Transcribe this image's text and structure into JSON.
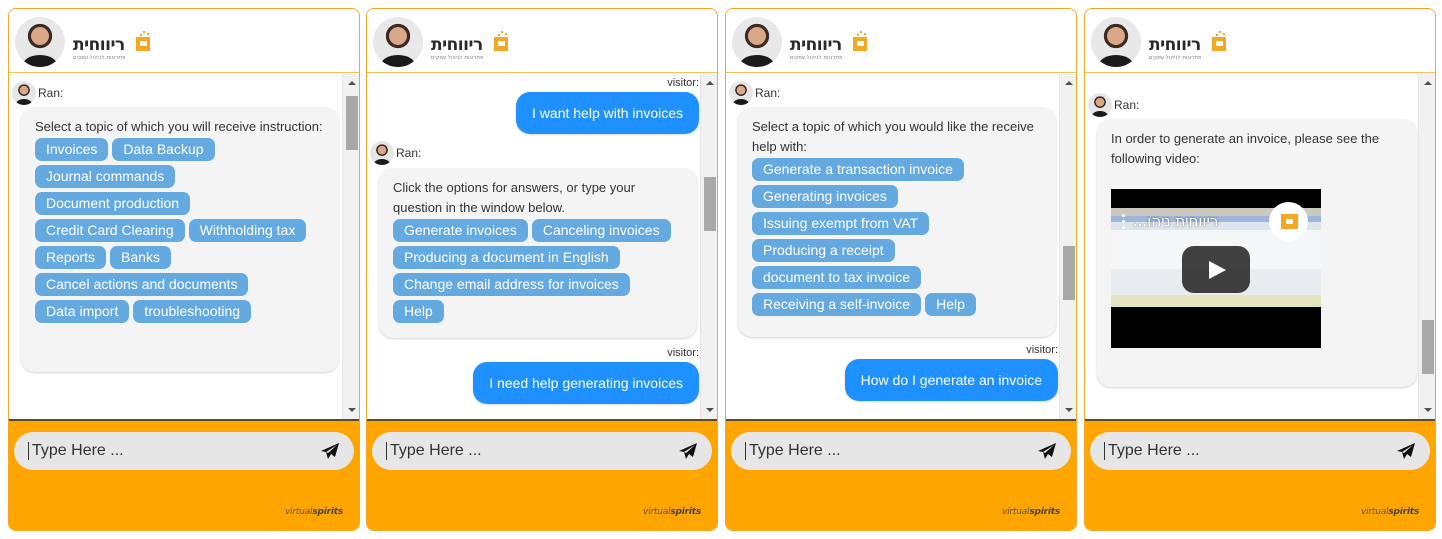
{
  "brand": {
    "logo_text": "ריווחית",
    "logo_subtitle": "פתרונות לניהול עסקים",
    "footer_brand_light": "virtual",
    "footer_brand_bold": "spirits",
    "accent_color": "#ffa500",
    "chip_color": "#64a9e0",
    "visitor_bubble_color": "#1e90ff"
  },
  "input": {
    "placeholder": "Type Here ..."
  },
  "labels": {
    "bot": "Ran:",
    "visitor": "visitor:"
  },
  "panels": [
    {
      "scroll_position": 0.05,
      "messages": [
        {
          "sender": "bot",
          "text": "Select a topic of which you will receive instruction:",
          "options": [
            "Invoices",
            "Data Backup",
            "Journal commands",
            "Document production",
            "Credit Card Clearing",
            "Withholding tax",
            "Reports",
            "Banks",
            "Cancel actions and documents",
            "Data import",
            "troubleshooting"
          ]
        }
      ]
    },
    {
      "scroll_position": 0.35,
      "messages": [
        {
          "sender": "visitor",
          "text": "I want help with invoices"
        },
        {
          "sender": "bot",
          "text": "Click the options for answers, or type your question in the window below.",
          "options": [
            "Generate invoices",
            "Canceling invoices",
            "Producing a document in English",
            "Change email address for invoices",
            "Help"
          ]
        },
        {
          "sender": "visitor",
          "text": "I need help generating invoices"
        }
      ]
    },
    {
      "scroll_position": 0.6,
      "messages": [
        {
          "sender": "bot",
          "text": "Select a topic of which you would like the receive help with:",
          "options": [
            "Generate a transaction invoice",
            "Generating invoices",
            "Issuing exempt from VAT",
            "Producing a receipt",
            "document to tax invoice",
            "Receiving a self-invoice",
            "Help"
          ]
        },
        {
          "sender": "visitor",
          "text": "How do I generate an invoice"
        }
      ]
    },
    {
      "scroll_position": 0.9,
      "messages": [
        {
          "sender": "bot",
          "text": "In order to generate an invoice, please see the following video:",
          "video": {
            "title": "ריווחית ניהו..."
          }
        }
      ]
    }
  ]
}
